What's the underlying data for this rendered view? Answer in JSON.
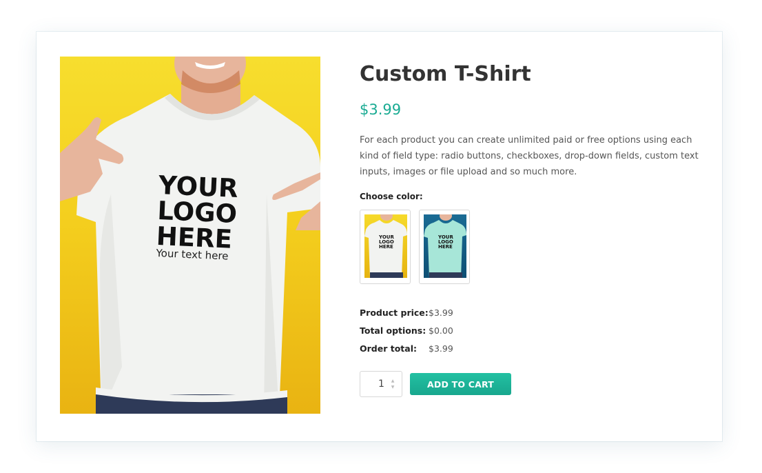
{
  "product": {
    "title": "Custom T-Shirt",
    "price": "$3.99",
    "description": "For each product you can create unlimited paid or free options using each kind of field type: radio buttons, checkboxes, drop-down fields, custom text inputs, images or file upload and so much more.",
    "image": {
      "logo_lines": [
        "YOUR",
        "LOGO",
        "HERE"
      ],
      "shirt_text": "Your text here"
    }
  },
  "color_option": {
    "label": "Choose color:",
    "swatches": [
      {
        "name": "yellow",
        "logo": "YOUR LOGO HERE"
      },
      {
        "name": "blue",
        "logo": "YOUR LOGO HERE"
      }
    ]
  },
  "totals": {
    "rows": [
      {
        "label": "Product price:",
        "value": "$3.99"
      },
      {
        "label": "Total options:",
        "value": "$0.00"
      },
      {
        "label": "Order total:",
        "value": "$3.99"
      }
    ]
  },
  "cart": {
    "quantity": "1",
    "add_to_cart_label": "ADD TO CART"
  },
  "colors": {
    "accent": "#1aab93",
    "button": "#1fb89b",
    "main_image_background": "#f4cf1e",
    "swatch_yellow": "#f6da2a",
    "swatch_blue": "#12618a"
  }
}
